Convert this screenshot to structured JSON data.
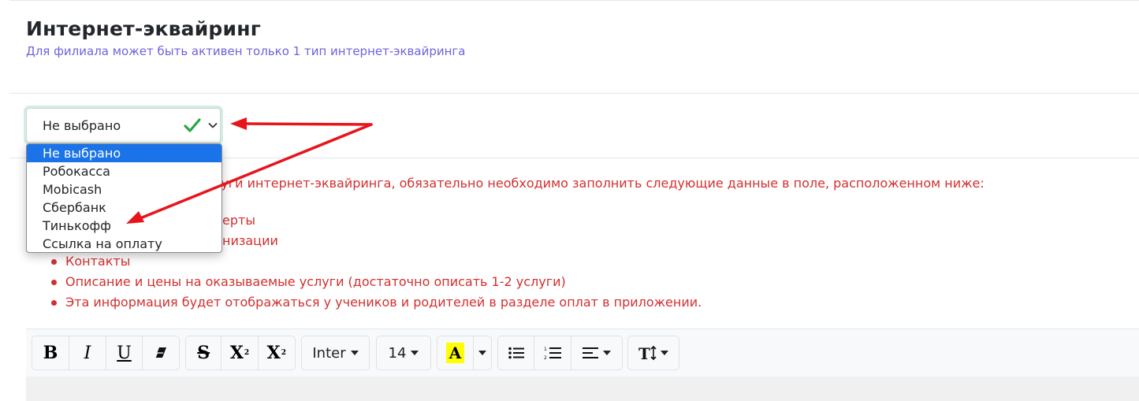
{
  "header": {
    "title": "Интернет-эквайринг",
    "subtitle": "Для филиала может быть активен только 1 тип интернет-эквайринга"
  },
  "acquiring_select": {
    "value": "Не выбрано",
    "options": [
      "Не выбрано",
      "Робокасса",
      "Mobicash",
      "Сбербанк",
      "Тинькофф",
      "Ссылка на оплату"
    ]
  },
  "info": {
    "intro_fragment": "луги интернет-эквайринга, обязательно необходимо заполнить следующие данные в поле, расположенном ниже:",
    "bullet1_fragment": "ерты",
    "bullet2_fragment": "низации",
    "bullets": [
      "Контакты",
      "Описание и цены на оказываемые услуги (достаточно описать 1-2 услуги)",
      "Эта информация будет отображаться у учеников и родителей в разделе оплат в приложении."
    ]
  },
  "toolbar": {
    "bold": "B",
    "italic": "I",
    "underline": "U",
    "strikethrough": "S",
    "superscript": "X",
    "superscript_mark": "2",
    "subscript": "X",
    "subscript_mark": "2",
    "font_family": "Inter",
    "font_size": "14",
    "highlight": "A"
  },
  "colors": {
    "accent": "#6f62e0",
    "warning_text": "#d32f2f",
    "selected_option": "#1a73e8",
    "check": "#28a745",
    "annotation_arrow": "#e8141c"
  }
}
